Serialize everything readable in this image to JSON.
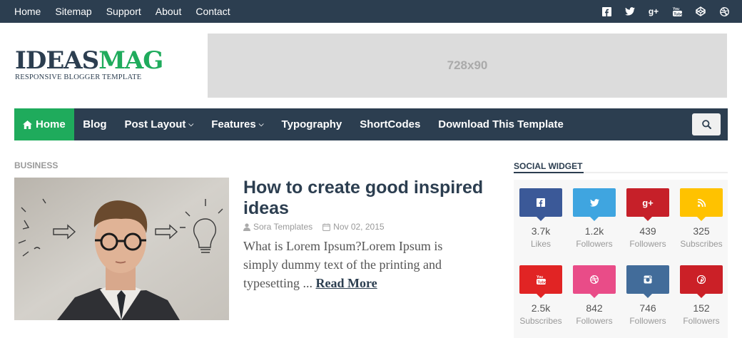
{
  "topnav": [
    "Home",
    "Sitemap",
    "Support",
    "About",
    "Contact"
  ],
  "top_social_icons": [
    "facebook-icon",
    "twitter-icon",
    "google-plus-icon",
    "youtube-icon",
    "codepen-icon",
    "dribbble-icon"
  ],
  "logo": {
    "part1": "IDEAS",
    "part2": "MAG",
    "tagline": "RESPONSIVE BLOGGER TEMPLATE"
  },
  "ad_text": "728x90",
  "mainnav": {
    "home": "Home",
    "items": [
      "Blog",
      "Post Layout",
      "Features",
      "Typography",
      "ShortCodes",
      "Download This Template"
    ]
  },
  "post": {
    "category": "BUSINESS",
    "title": "How to create good inspired ideas",
    "author": "Sora Templates",
    "date": "Nov 02, 2015",
    "excerpt": "What is Lorem Ipsum?Lorem Ipsum is simply dummy text of the printing and typesetting ...",
    "read_more": "Read More"
  },
  "sidebar": {
    "widget_title": "SOCIAL WIDGET",
    "items": [
      {
        "icon": "facebook-icon",
        "count": "3.7k",
        "label": "Likes",
        "color": "#3b5998"
      },
      {
        "icon": "twitter-icon",
        "count": "1.2k",
        "label": "Followers",
        "color": "#3fa5e0"
      },
      {
        "icon": "google-plus-icon",
        "count": "439",
        "label": "Followers",
        "color": "#c62029"
      },
      {
        "icon": "rss-icon",
        "count": "325",
        "label": "Subscribes",
        "color": "#ffc200"
      },
      {
        "icon": "youtube-icon",
        "count": "2.5k",
        "label": "Subscribes",
        "color": "#e12424"
      },
      {
        "icon": "dribbble-icon",
        "count": "842",
        "label": "Followers",
        "color": "#e94c88"
      },
      {
        "icon": "instagram-icon",
        "count": "746",
        "label": "Followers",
        "color": "#426c9a"
      },
      {
        "icon": "pinterest-icon",
        "count": "152",
        "label": "Followers",
        "color": "#cb2027"
      }
    ]
  }
}
